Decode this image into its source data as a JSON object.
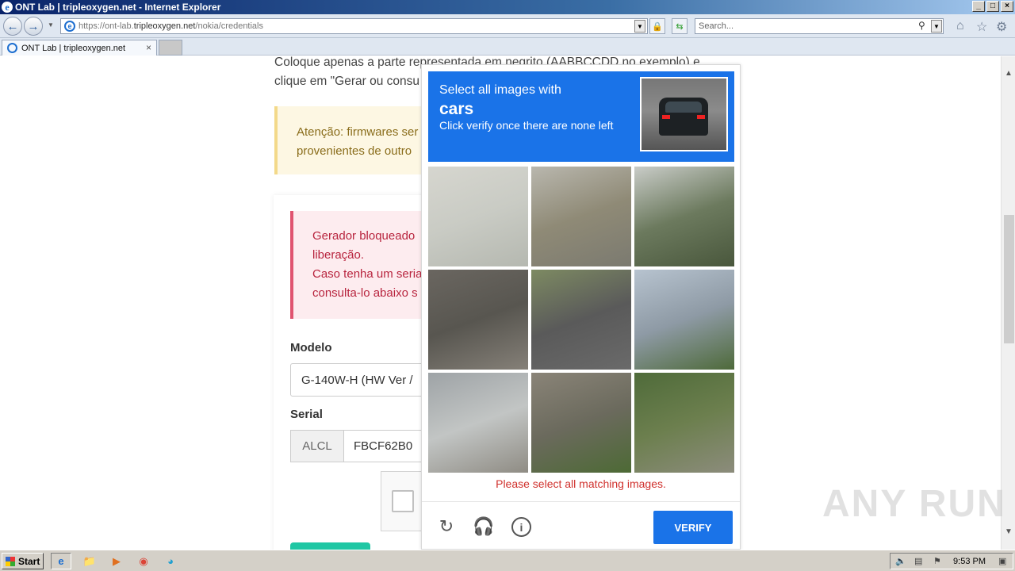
{
  "window": {
    "title": "ONT Lab | tripleoxygen.net - Internet Explorer"
  },
  "address": {
    "url_prefix": "https://ont-lab.",
    "url_domain": "tripleoxygen.net",
    "url_path": "/nokia/credentials"
  },
  "search": {
    "placeholder": "Search..."
  },
  "tab": {
    "label": "ONT Lab | tripleoxygen.net"
  },
  "page": {
    "intro": "Coloque apenas a parte representada em negrito (AABBCCDD no exemplo) e clique em \"Gerar ou consu",
    "warning": "Atenção: firmwares ser\nprovenientes de outro",
    "danger": "Gerador bloqueado\nliberação.\nCaso tenha um seria\nconsulta-lo abaixo s",
    "model_label": "Modelo",
    "model_value": "G-140W-H (HW Ver /",
    "serial_label": "Serial",
    "serial_prefix": "ALCL",
    "serial_value": "FBCF62B0"
  },
  "captcha": {
    "line1": "Select all images with",
    "target": "cars",
    "line3": "Click verify once there are none left",
    "error": "Please select all matching images.",
    "verify": "VERIFY",
    "tiles": [
      {
        "icon": "palm-street-image",
        "colors": [
          "#d6d6cf",
          "#c9cbc4",
          "#b5b8b0"
        ]
      },
      {
        "icon": "overpass-road-image",
        "colors": [
          "#b9b7ae",
          "#8f8a76",
          "#7b7a70"
        ]
      },
      {
        "icon": "palm-tree-image",
        "colors": [
          "#c9ccc8",
          "#6c7a5e",
          "#49573c"
        ]
      },
      {
        "icon": "crosswalk-image",
        "colors": [
          "#6a6660",
          "#585650",
          "#858078"
        ]
      },
      {
        "icon": "road-line-image",
        "colors": [
          "#7d8a62",
          "#5a5a5a",
          "#6a6a6a"
        ]
      },
      {
        "icon": "traffic-light-image",
        "colors": [
          "#b7c3cf",
          "#8e9aa5",
          "#4e6a3a"
        ]
      },
      {
        "icon": "bridge-structure-image",
        "colors": [
          "#9ea3a6",
          "#c2c5c4",
          "#8f8c84"
        ]
      },
      {
        "icon": "highway-trees-image",
        "colors": [
          "#8a8478",
          "#6b6a5d",
          "#4d6a35"
        ]
      },
      {
        "icon": "bridge-bushes-image",
        "colors": [
          "#4f6b3a",
          "#6c7f4e",
          "#8c8c7c"
        ]
      }
    ]
  },
  "watermark": "ANY RUN",
  "taskbar": {
    "start": "Start",
    "time": "9:53 PM"
  }
}
